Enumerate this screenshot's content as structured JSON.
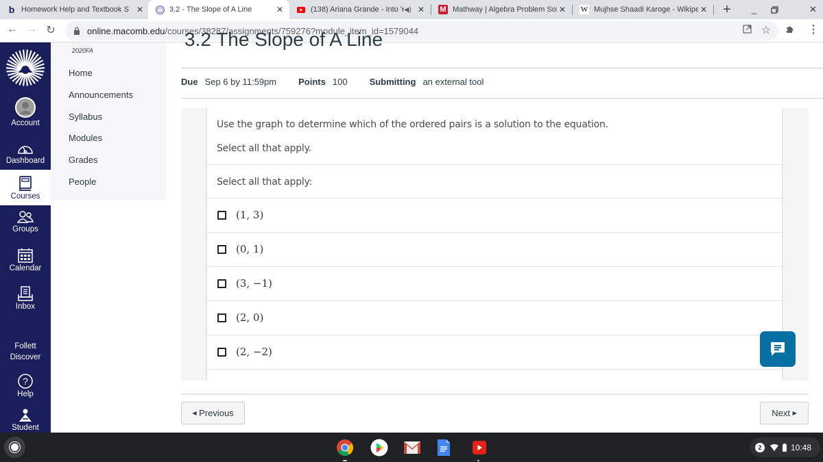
{
  "browser": {
    "tabs": [
      {
        "title": "Homework Help and Textbook S",
        "favicon": "b",
        "active": false
      },
      {
        "title": "3.2 - The Slope of A Line",
        "favicon": "canvas-logo",
        "active": true
      },
      {
        "title": "(138) Ariana Grande - Into Y",
        "favicon": "youtube-logo",
        "active": false,
        "audio": true
      },
      {
        "title": "Mathway | Algebra Problem Sol",
        "favicon": "M",
        "active": false
      },
      {
        "title": "Mujhse Shaadi Karoge - Wikipe",
        "favicon": "W",
        "active": false
      }
    ],
    "close_glyph": "✕",
    "new_tab_glyph": "+",
    "url_host": "online.macomb.edu",
    "url_path": "/courses/38287/assignments/759276?module_item_id=1579044"
  },
  "global_nav": {
    "items": [
      {
        "label": "Account",
        "icon": "account-icon"
      },
      {
        "label": "Dashboard",
        "icon": "dashboard-icon"
      },
      {
        "label": "Courses",
        "icon": "courses-icon",
        "active": true
      },
      {
        "label": "Groups",
        "icon": "groups-icon"
      },
      {
        "label": "Calendar",
        "icon": "calendar-icon"
      },
      {
        "label": "Inbox",
        "icon": "inbox-icon"
      },
      {
        "label": "Follett Discover",
        "label_line1": "Follett",
        "label_line2": "Discover"
      },
      {
        "label": "Help",
        "icon": "help-icon"
      },
      {
        "label": "Student",
        "icon": "student-icon"
      }
    ]
  },
  "course_nav": {
    "term": "2020FA",
    "items": [
      "Home",
      "Announcements",
      "Syllabus",
      "Modules",
      "Grades",
      "People"
    ]
  },
  "assignment": {
    "title": "3.2   The Slope of A Line",
    "due_label": "Due",
    "due_value": "Sep 6 by 11:59pm",
    "points_label": "Points",
    "points_value": "100",
    "submitting_label": "Submitting",
    "submitting_value": "an external tool"
  },
  "question": {
    "prompt": "Use the graph to determine which of the ordered pairs is a solution to the equation.",
    "instruction": "Select all that apply.",
    "select_label": "Select all that apply:",
    "choices": [
      {
        "label": "(1, 3)",
        "checked": false
      },
      {
        "label": "(0, 1)",
        "checked": false
      },
      {
        "label": "(3, −1)",
        "checked": false
      },
      {
        "label": "(2, 0)",
        "checked": false
      },
      {
        "label": "(2, −2)",
        "checked": false
      }
    ]
  },
  "footer": {
    "previous_label": "Previous",
    "next_label": "Next"
  },
  "taskbar": {
    "apps": [
      "chrome",
      "play-store",
      "gmail",
      "docs",
      "youtube"
    ],
    "notification_count": "2",
    "time": "10:48"
  },
  "colors": {
    "canvas_nav": "#1a1f5c",
    "chat_button": "#0770a3"
  }
}
